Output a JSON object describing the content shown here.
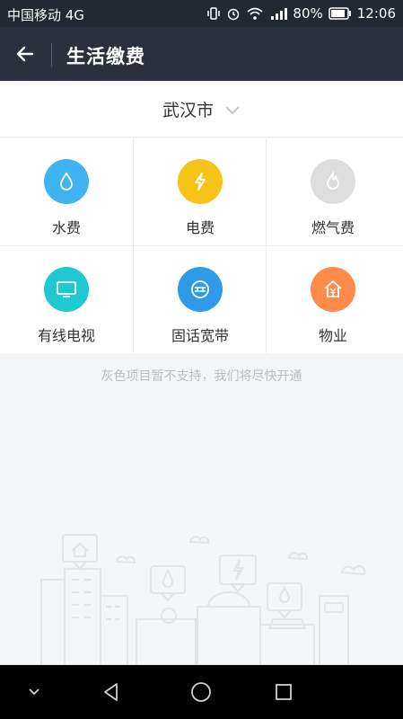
{
  "status_bar": {
    "carrier": "中国移动 4G",
    "battery": "80%",
    "time": "12:06"
  },
  "header": {
    "title": "生活缴费"
  },
  "city": {
    "name": "武汉市"
  },
  "services": [
    {
      "label": "水费",
      "color": "#3fb4f0",
      "icon": "water-drop-icon"
    },
    {
      "label": "电费",
      "color": "#f6c418",
      "icon": "lightning-icon"
    },
    {
      "label": "燃气费",
      "color": "#dddddd",
      "icon": "flame-icon"
    },
    {
      "label": "有线电视",
      "color": "#20c8d2",
      "icon": "tv-icon"
    },
    {
      "label": "固话宽带",
      "color": "#2f9be8",
      "icon": "phone-broadband-icon"
    },
    {
      "label": "物业",
      "color": "#ff8a4a",
      "icon": "property-house-icon"
    }
  ],
  "notice": "灰色项目暂不支持，我们将尽快开通"
}
